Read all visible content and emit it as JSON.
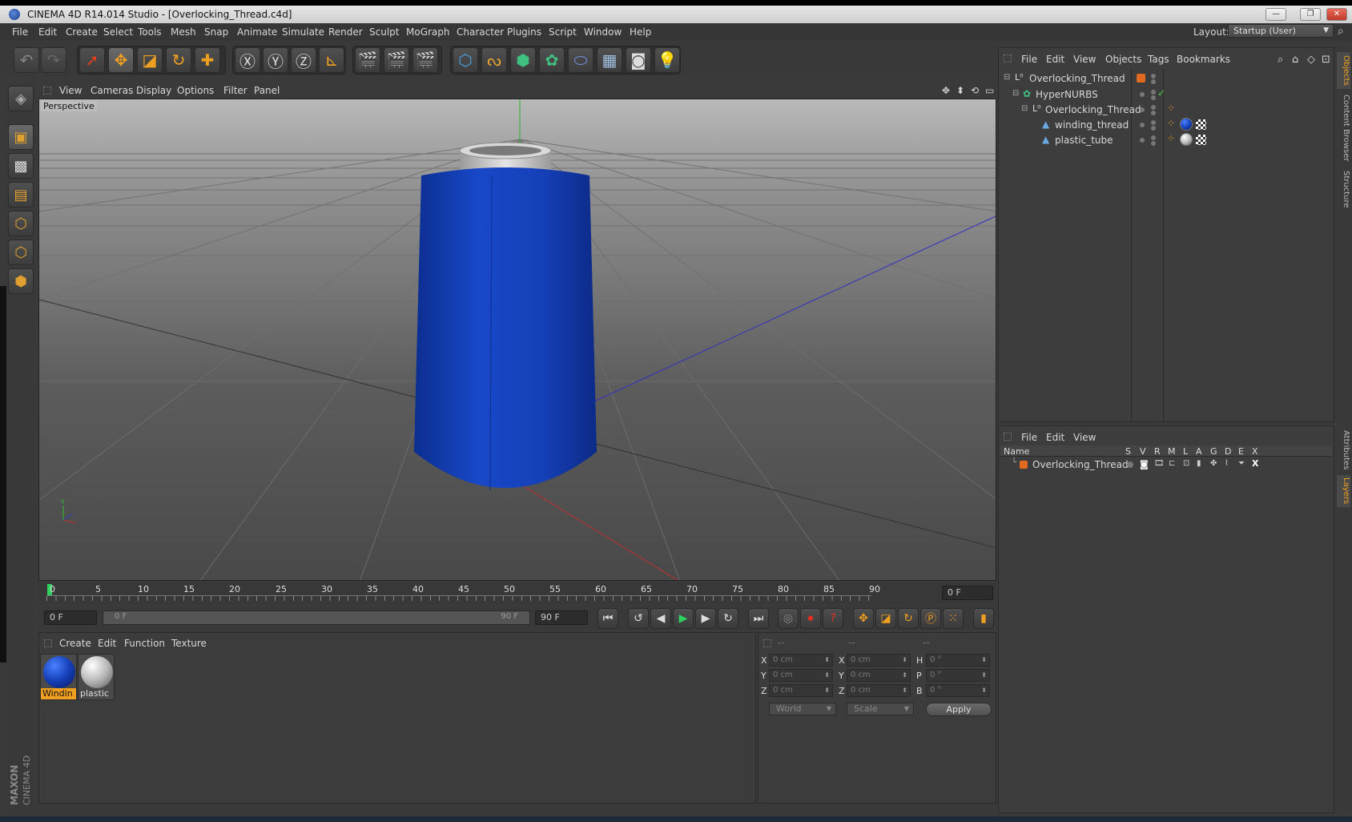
{
  "window": {
    "title": "CINEMA 4D R14.014 Studio - [Overlocking_Thread.c4d]",
    "buttons": [
      "—",
      "❐",
      "✕"
    ]
  },
  "menubar": {
    "items": [
      "File",
      "Edit",
      "Create",
      "Select",
      "Tools",
      "Mesh",
      "Snap",
      "Animate",
      "Simulate",
      "Render",
      "Sculpt",
      "MoGraph",
      "Character",
      "Plugins",
      "Script",
      "Window",
      "Help"
    ],
    "layout_label": "Layout:",
    "layout_value": "Startup (User)"
  },
  "viewport": {
    "menu": [
      "View",
      "Cameras",
      "Display",
      "Options",
      "Filter",
      "Panel"
    ],
    "label": "Perspective"
  },
  "timeline": {
    "ticks": [
      "0",
      "5",
      "10",
      "15",
      "20",
      "25",
      "30",
      "35",
      "40",
      "45",
      "50",
      "55",
      "60",
      "65",
      "70",
      "75",
      "80",
      "85",
      "90"
    ],
    "current_frame": "0 F",
    "start_field": "0 F",
    "range_start": "0 F",
    "range_end": "90 F",
    "end_field": "90 F"
  },
  "materials": {
    "menu": [
      "Create",
      "Edit",
      "Function",
      "Texture"
    ],
    "items": [
      {
        "name": "Windin",
        "color": "#1540b8",
        "selected": true
      },
      {
        "name": "plastic",
        "color": "#b8b8b8",
        "selected": false
      }
    ]
  },
  "coordinates": {
    "headers": [
      "--",
      "--",
      "--"
    ],
    "rows": [
      {
        "a_label": "X",
        "a_val": "0 cm",
        "b_label": "X",
        "b_val": "0 cm",
        "c_label": "H",
        "c_val": "0 °"
      },
      {
        "a_label": "Y",
        "a_val": "0 cm",
        "b_label": "Y",
        "b_val": "0 cm",
        "c_label": "P",
        "c_val": "0 °"
      },
      {
        "a_label": "Z",
        "a_val": "0 cm",
        "b_label": "Z",
        "b_val": "0 cm",
        "c_label": "B",
        "c_val": "0 °"
      }
    ],
    "mode1": "World",
    "mode2": "Scale",
    "apply": "Apply"
  },
  "objects": {
    "menu": [
      "File",
      "Edit",
      "View",
      "Objects",
      "Tags",
      "Bookmarks"
    ],
    "tree": [
      {
        "name": "Overlocking_Thread"
      },
      {
        "name": "HyperNURBS"
      },
      {
        "name": "Overlocking_Thread"
      },
      {
        "name": "winding_thread"
      },
      {
        "name": "plastic_tube"
      }
    ]
  },
  "layers": {
    "menu": [
      "File",
      "Edit",
      "View"
    ],
    "columns": [
      "Name",
      "S",
      "V",
      "R",
      "M",
      "L",
      "A",
      "G",
      "D",
      "E",
      "X"
    ],
    "rows": [
      {
        "name": "Overlocking_Thread"
      }
    ]
  },
  "side_tabs": [
    "Objects",
    "Content Browser",
    "Structure",
    "Attributes",
    "Layers"
  ],
  "branding": {
    "line1": "MAXON",
    "line2": "CINEMA 4D"
  },
  "colors": {
    "accent": "#f0a020",
    "thread": "#1540b8",
    "panel": "#3d3d3d"
  }
}
